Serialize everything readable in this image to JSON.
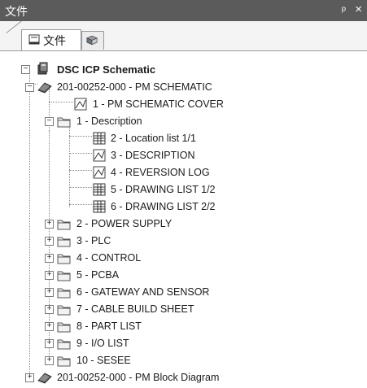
{
  "titlebar": {
    "title": "文件",
    "pin": "ᵖ",
    "close": "×"
  },
  "tabs": [
    {
      "label": "文件",
      "icon": "file-tree-icon"
    },
    {
      "label": "",
      "icon": "cube-icon"
    }
  ],
  "tree": {
    "root": {
      "label": "DSC ICP Schematic",
      "expander": "−",
      "icon": "project-icon"
    },
    "nodes": [
      {
        "label": "201-00252-000 - PM SCHEMATIC",
        "expander": "−",
        "icon": "book-icon"
      },
      {
        "label": "1 - PM SCHEMATIC COVER",
        "icon": "drawing-icon"
      },
      {
        "label": "1 - Description",
        "expander": "−",
        "icon": "folder-icon"
      },
      {
        "label": "2 - Location list 1/1",
        "icon": "table-icon"
      },
      {
        "label": "3 - DESCRIPTION",
        "icon": "drawing-icon"
      },
      {
        "label": "4 - REVERSION LOG",
        "icon": "drawing-icon"
      },
      {
        "label": "5 - DRAWING LIST 1/2",
        "icon": "table-icon"
      },
      {
        "label": "6 - DRAWING LIST 2/2",
        "icon": "table-icon"
      },
      {
        "label": "2 - POWER SUPPLY",
        "expander": "+",
        "icon": "folder-icon"
      },
      {
        "label": "3 - PLC",
        "expander": "+",
        "icon": "folder-icon"
      },
      {
        "label": "4 - CONTROL",
        "expander": "+",
        "icon": "folder-icon"
      },
      {
        "label": "5 - PCBA",
        "expander": "+",
        "icon": "folder-icon"
      },
      {
        "label": "6 - GATEWAY AND SENSOR",
        "expander": "+",
        "icon": "folder-icon"
      },
      {
        "label": "7 - CABLE BUILD SHEET",
        "expander": "+",
        "icon": "folder-icon"
      },
      {
        "label": "8 - PART LIST",
        "expander": "+",
        "icon": "folder-icon"
      },
      {
        "label": "9 - I/O LIST",
        "expander": "+",
        "icon": "folder-icon"
      },
      {
        "label": "10 - SESEE",
        "expander": "+",
        "icon": "folder-icon"
      },
      {
        "label": "201-00252-000 - PM Block Diagram",
        "expander": "+",
        "icon": "book-icon"
      }
    ]
  }
}
